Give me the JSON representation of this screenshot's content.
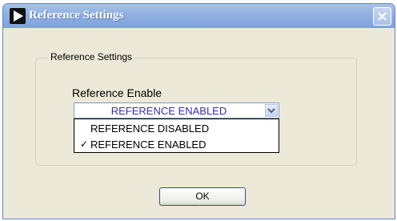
{
  "window": {
    "title": "Reference Settings",
    "app_icon": "play-arrow-icon",
    "close_icon": "close-icon"
  },
  "groupbox": {
    "legend": "Reference Settings"
  },
  "reference_enable": {
    "label": "Reference Enable",
    "selected_value": "REFERENCE ENABLED",
    "arrow_icon": "chevron-down-icon",
    "options": [
      {
        "label": "REFERENCE DISABLED",
        "checked": false
      },
      {
        "label": "REFERENCE ENABLED",
        "checked": true
      }
    ],
    "check_mark": "✓"
  },
  "buttons": {
    "ok_label": "OK"
  },
  "colors": {
    "titlebar": "#8fb0e3",
    "dialog_bg": "#ece9d8",
    "selected_text": "#3a2bb5"
  }
}
